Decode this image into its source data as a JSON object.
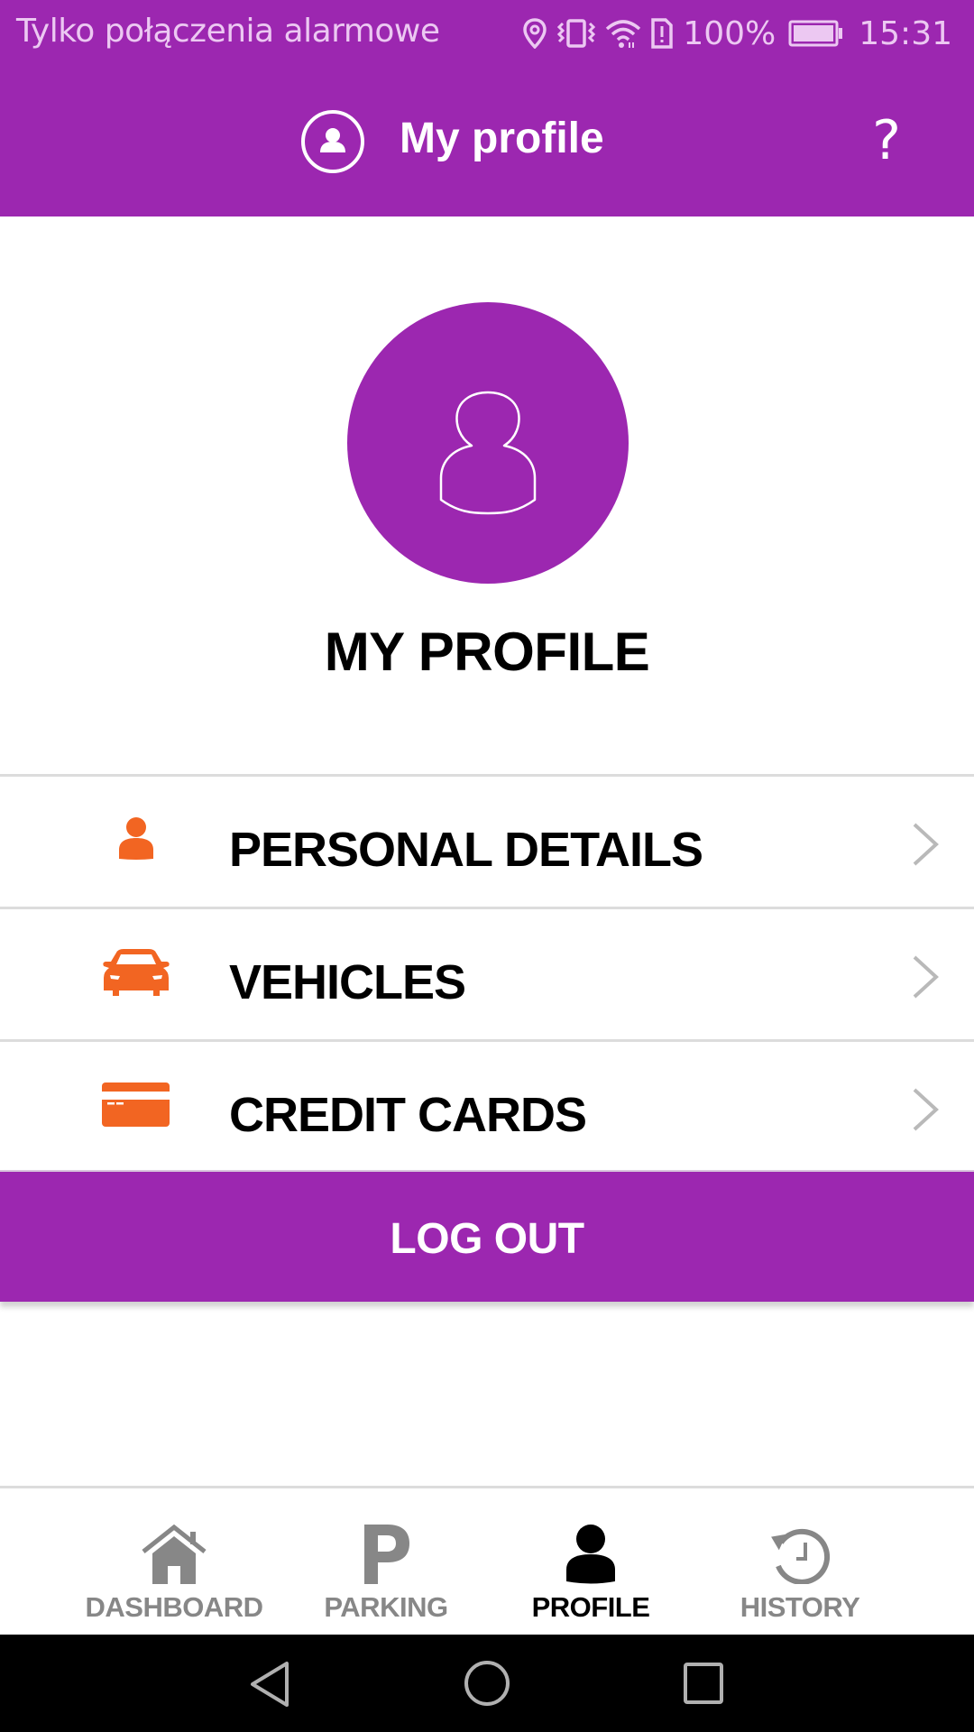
{
  "status_bar": {
    "carrier_text": "Tylko połączenia alarmowe",
    "icons": [
      "location-icon",
      "vibrate-icon",
      "wifi-icon",
      "sim-alert-icon",
      "battery-icon"
    ],
    "battery_percent": "100%",
    "time": "15:31"
  },
  "app_bar": {
    "title": "My profile",
    "help_label": "?",
    "icon": "profile-circle-icon"
  },
  "profile": {
    "heading": "MY PROFILE",
    "avatar_icon": "user-outline-icon"
  },
  "menu": {
    "items": [
      {
        "label": "PERSONAL DETAILS",
        "icon": "person-icon"
      },
      {
        "label": "VEHICLES",
        "icon": "car-icon"
      },
      {
        "label": "CREDIT CARDS",
        "icon": "credit-card-icon"
      }
    ]
  },
  "logout": {
    "label": "LOG OUT"
  },
  "bottom_nav": {
    "items": [
      {
        "label": "DASHBOARD",
        "icon": "home-icon",
        "active": false
      },
      {
        "label": "PARKING",
        "icon": "parking-icon",
        "active": false
      },
      {
        "label": "PROFILE",
        "icon": "person-icon",
        "active": true
      },
      {
        "label": "HISTORY",
        "icon": "history-icon",
        "active": false
      }
    ]
  },
  "colors": {
    "primary": "#9c27b0",
    "accent": "#f26522",
    "inactive": "#878787",
    "divider": "#dcdcdc"
  }
}
